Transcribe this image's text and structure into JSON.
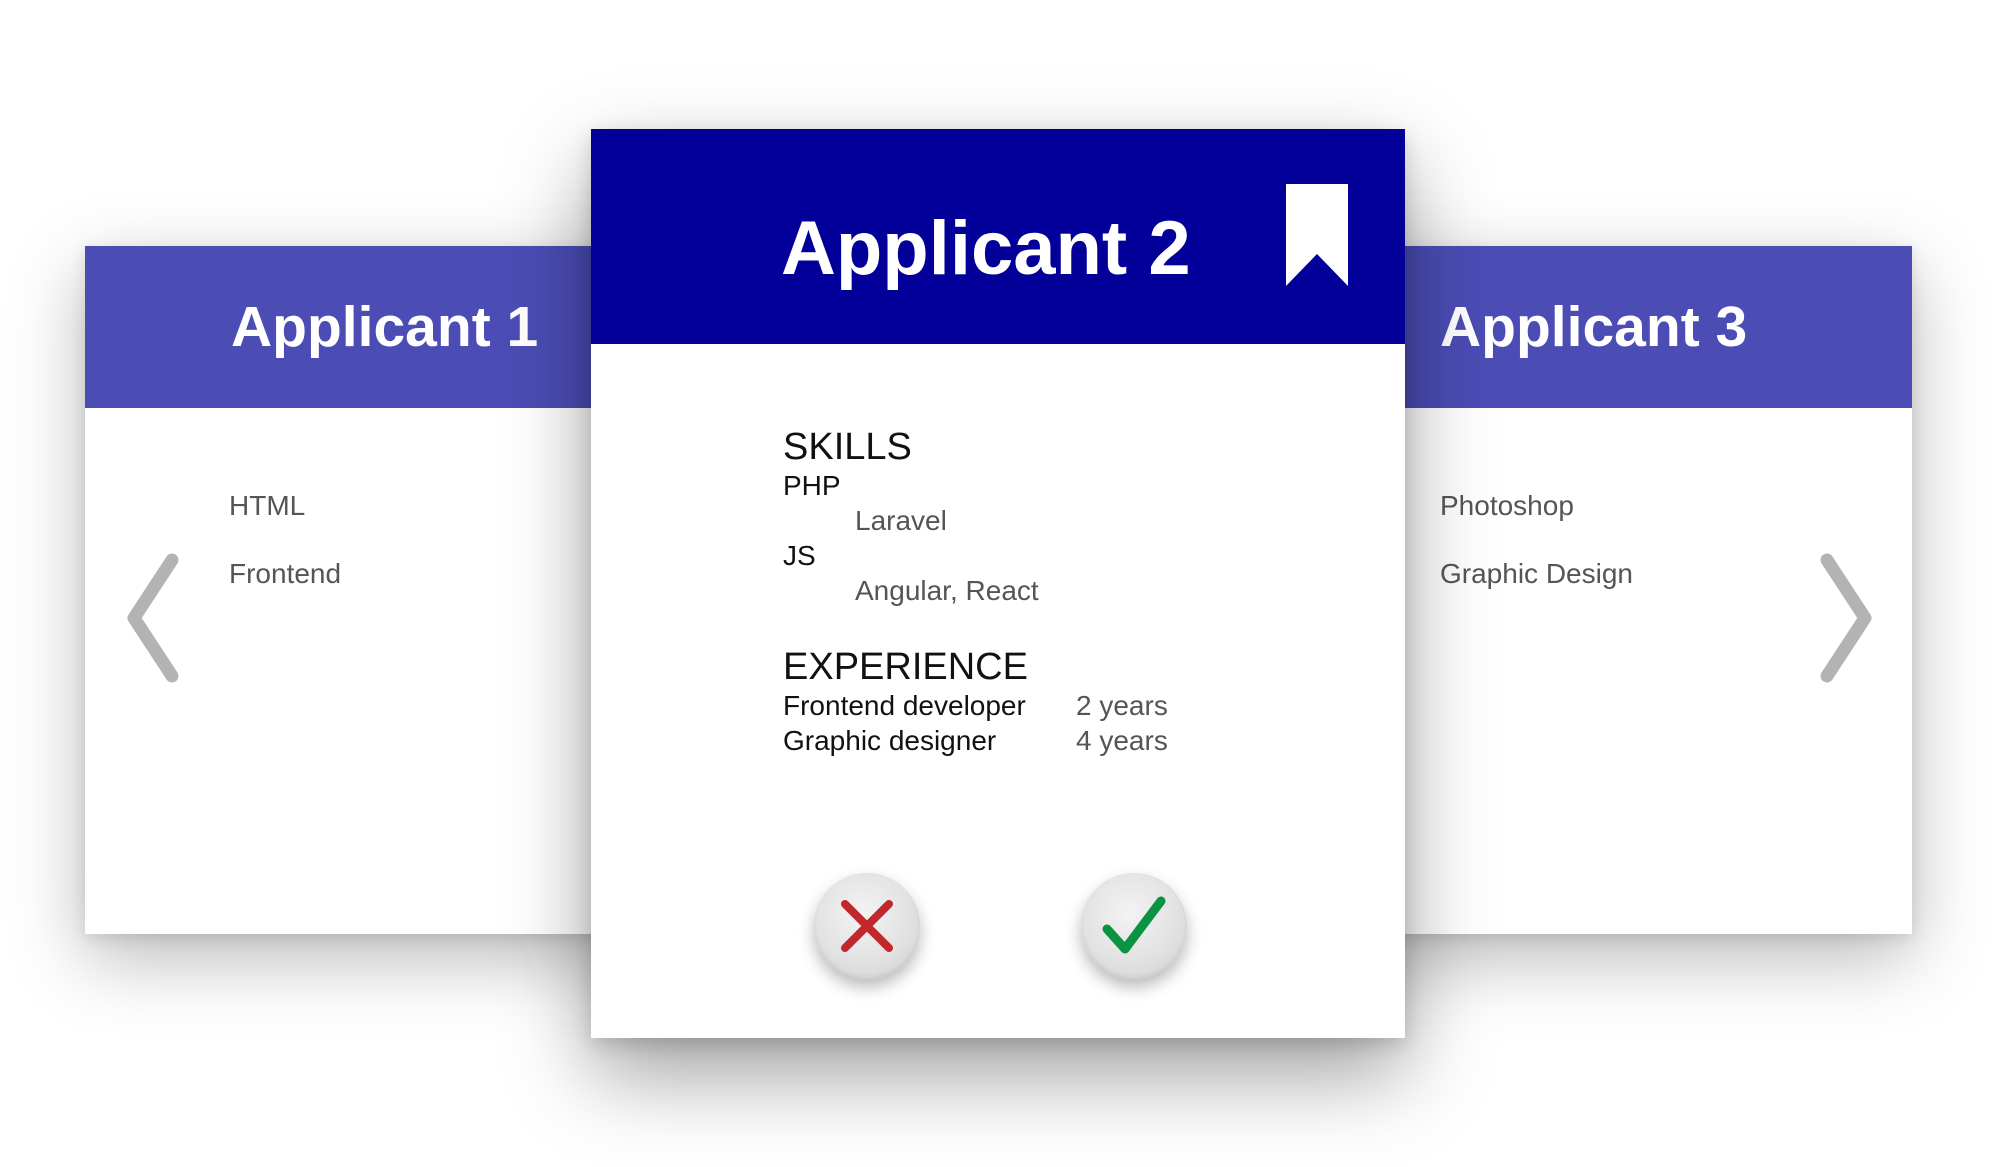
{
  "applicants": {
    "left": {
      "title": "Applicant 1",
      "skills": [
        "HTML",
        "Frontend"
      ]
    },
    "main": {
      "title": "Applicant 2",
      "skills_heading": "SKILLS",
      "skills": [
        {
          "name": "PHP",
          "detail": "Laravel"
        },
        {
          "name": "JS",
          "detail": "Angular, React"
        }
      ],
      "experience_heading": "EXPERIENCE",
      "experience": [
        {
          "role": "Frontend developer",
          "years": "2 years"
        },
        {
          "role": "Graphic designer",
          "years": "4 years"
        }
      ]
    },
    "right": {
      "title": "Applicant 3",
      "skills": [
        "Photoshop",
        "Graphic Design"
      ]
    }
  },
  "icons": {
    "previous": "chevron-left-icon",
    "next": "chevron-right-icon",
    "bookmark": "bookmark-icon",
    "reject": "x-icon",
    "accept": "checkmark-icon"
  },
  "colors": {
    "main_header": "#020099",
    "side_header": "#4b4db5",
    "reject": "#c1272d",
    "accept": "#0a9442",
    "chevron": "#b3b3b3"
  }
}
